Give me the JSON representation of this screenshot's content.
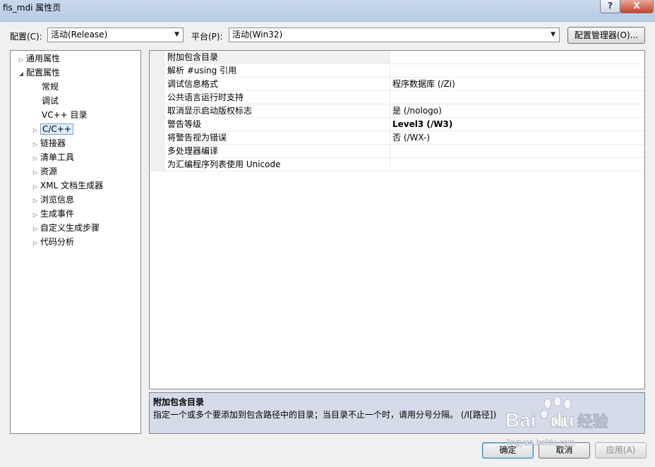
{
  "window": {
    "title": "fis_mdi 属性页",
    "help_label": "?",
    "close_label": "X"
  },
  "config": {
    "label": "配置(C):",
    "value": "活动(Release)",
    "platform_label": "平台(P):",
    "platform_value": "活动(Win32)",
    "manager_button": "配置管理器(O)..."
  },
  "tree": {
    "items": [
      {
        "label": "通用属性",
        "expander": "▷"
      },
      {
        "label": "配置属性",
        "expander": "◢"
      },
      {
        "label": "常规",
        "expander": ""
      },
      {
        "label": "调试",
        "expander": ""
      },
      {
        "label": "VC++ 目录",
        "expander": ""
      },
      {
        "label": "C/C++",
        "expander": "▷"
      },
      {
        "label": "链接器",
        "expander": "▷"
      },
      {
        "label": "清单工具",
        "expander": "▷"
      },
      {
        "label": "资源",
        "expander": "▷"
      },
      {
        "label": "XML 文档生成器",
        "expander": "▷"
      },
      {
        "label": "浏览信息",
        "expander": "▷"
      },
      {
        "label": "生成事件",
        "expander": "▷"
      },
      {
        "label": "自定义生成步骤",
        "expander": "▷"
      },
      {
        "label": "代码分析",
        "expander": "▷"
      }
    ]
  },
  "grid": {
    "rows": [
      {
        "name": "附加包含目录",
        "value": ""
      },
      {
        "name": "解析 #using 引用",
        "value": ""
      },
      {
        "name": "调试信息格式",
        "value": "程序数据库 (/Zi)"
      },
      {
        "name": "公共语言运行时支持",
        "value": ""
      },
      {
        "name": "取消显示启动版权标志",
        "value": "是 (/nologo)"
      },
      {
        "name": "警告等级",
        "value": "Level3 (/W3)"
      },
      {
        "name": "将警告视为错误",
        "value": "否 (/WX-)"
      },
      {
        "name": "多处理器编译",
        "value": ""
      },
      {
        "name": "为汇编程序列表使用 Unicode",
        "value": ""
      }
    ]
  },
  "description": {
    "title": "附加包含目录",
    "text": "指定一个或多个要添加到包含路径中的目录；当目录不止一个时，请用分号分隔。      (/I[路径])"
  },
  "buttons": {
    "ok": "确定",
    "cancel": "取消",
    "apply": "应用(A)"
  },
  "watermark": {
    "brand": "Bai",
    "brand2": "du",
    "suffix": "经验",
    "url": "jingyan.baidu.com"
  }
}
